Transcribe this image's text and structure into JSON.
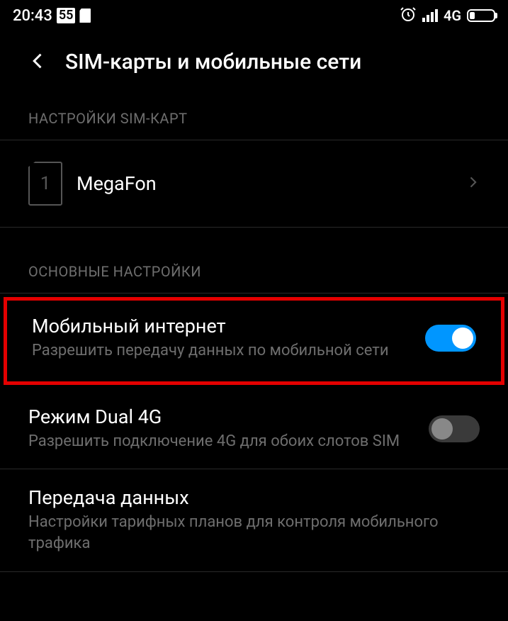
{
  "status_bar": {
    "time": "20:43",
    "badge": "55",
    "network": "4G"
  },
  "header": {
    "title": "SIM-карты и мобильные сети"
  },
  "sections": {
    "sim_settings": {
      "label": "НАСТРОЙКИ SIM-КАРТ",
      "sim1": {
        "slot": "1",
        "carrier": "MegaFon"
      }
    },
    "main_settings": {
      "label": "ОСНОВНЫЕ НАСТРОЙКИ",
      "mobile_data": {
        "title": "Мобильный интернет",
        "subtitle": "Разрешить передачу данных по мобильной сети",
        "enabled": true
      },
      "dual_4g": {
        "title": "Режим Dual 4G",
        "subtitle": "Разрешить подключение 4G для обоих слотов SIM",
        "enabled": false
      },
      "data_usage": {
        "title": "Передача данных",
        "subtitle": "Настройки тарифных планов для контроля мобильного трафика"
      }
    }
  }
}
